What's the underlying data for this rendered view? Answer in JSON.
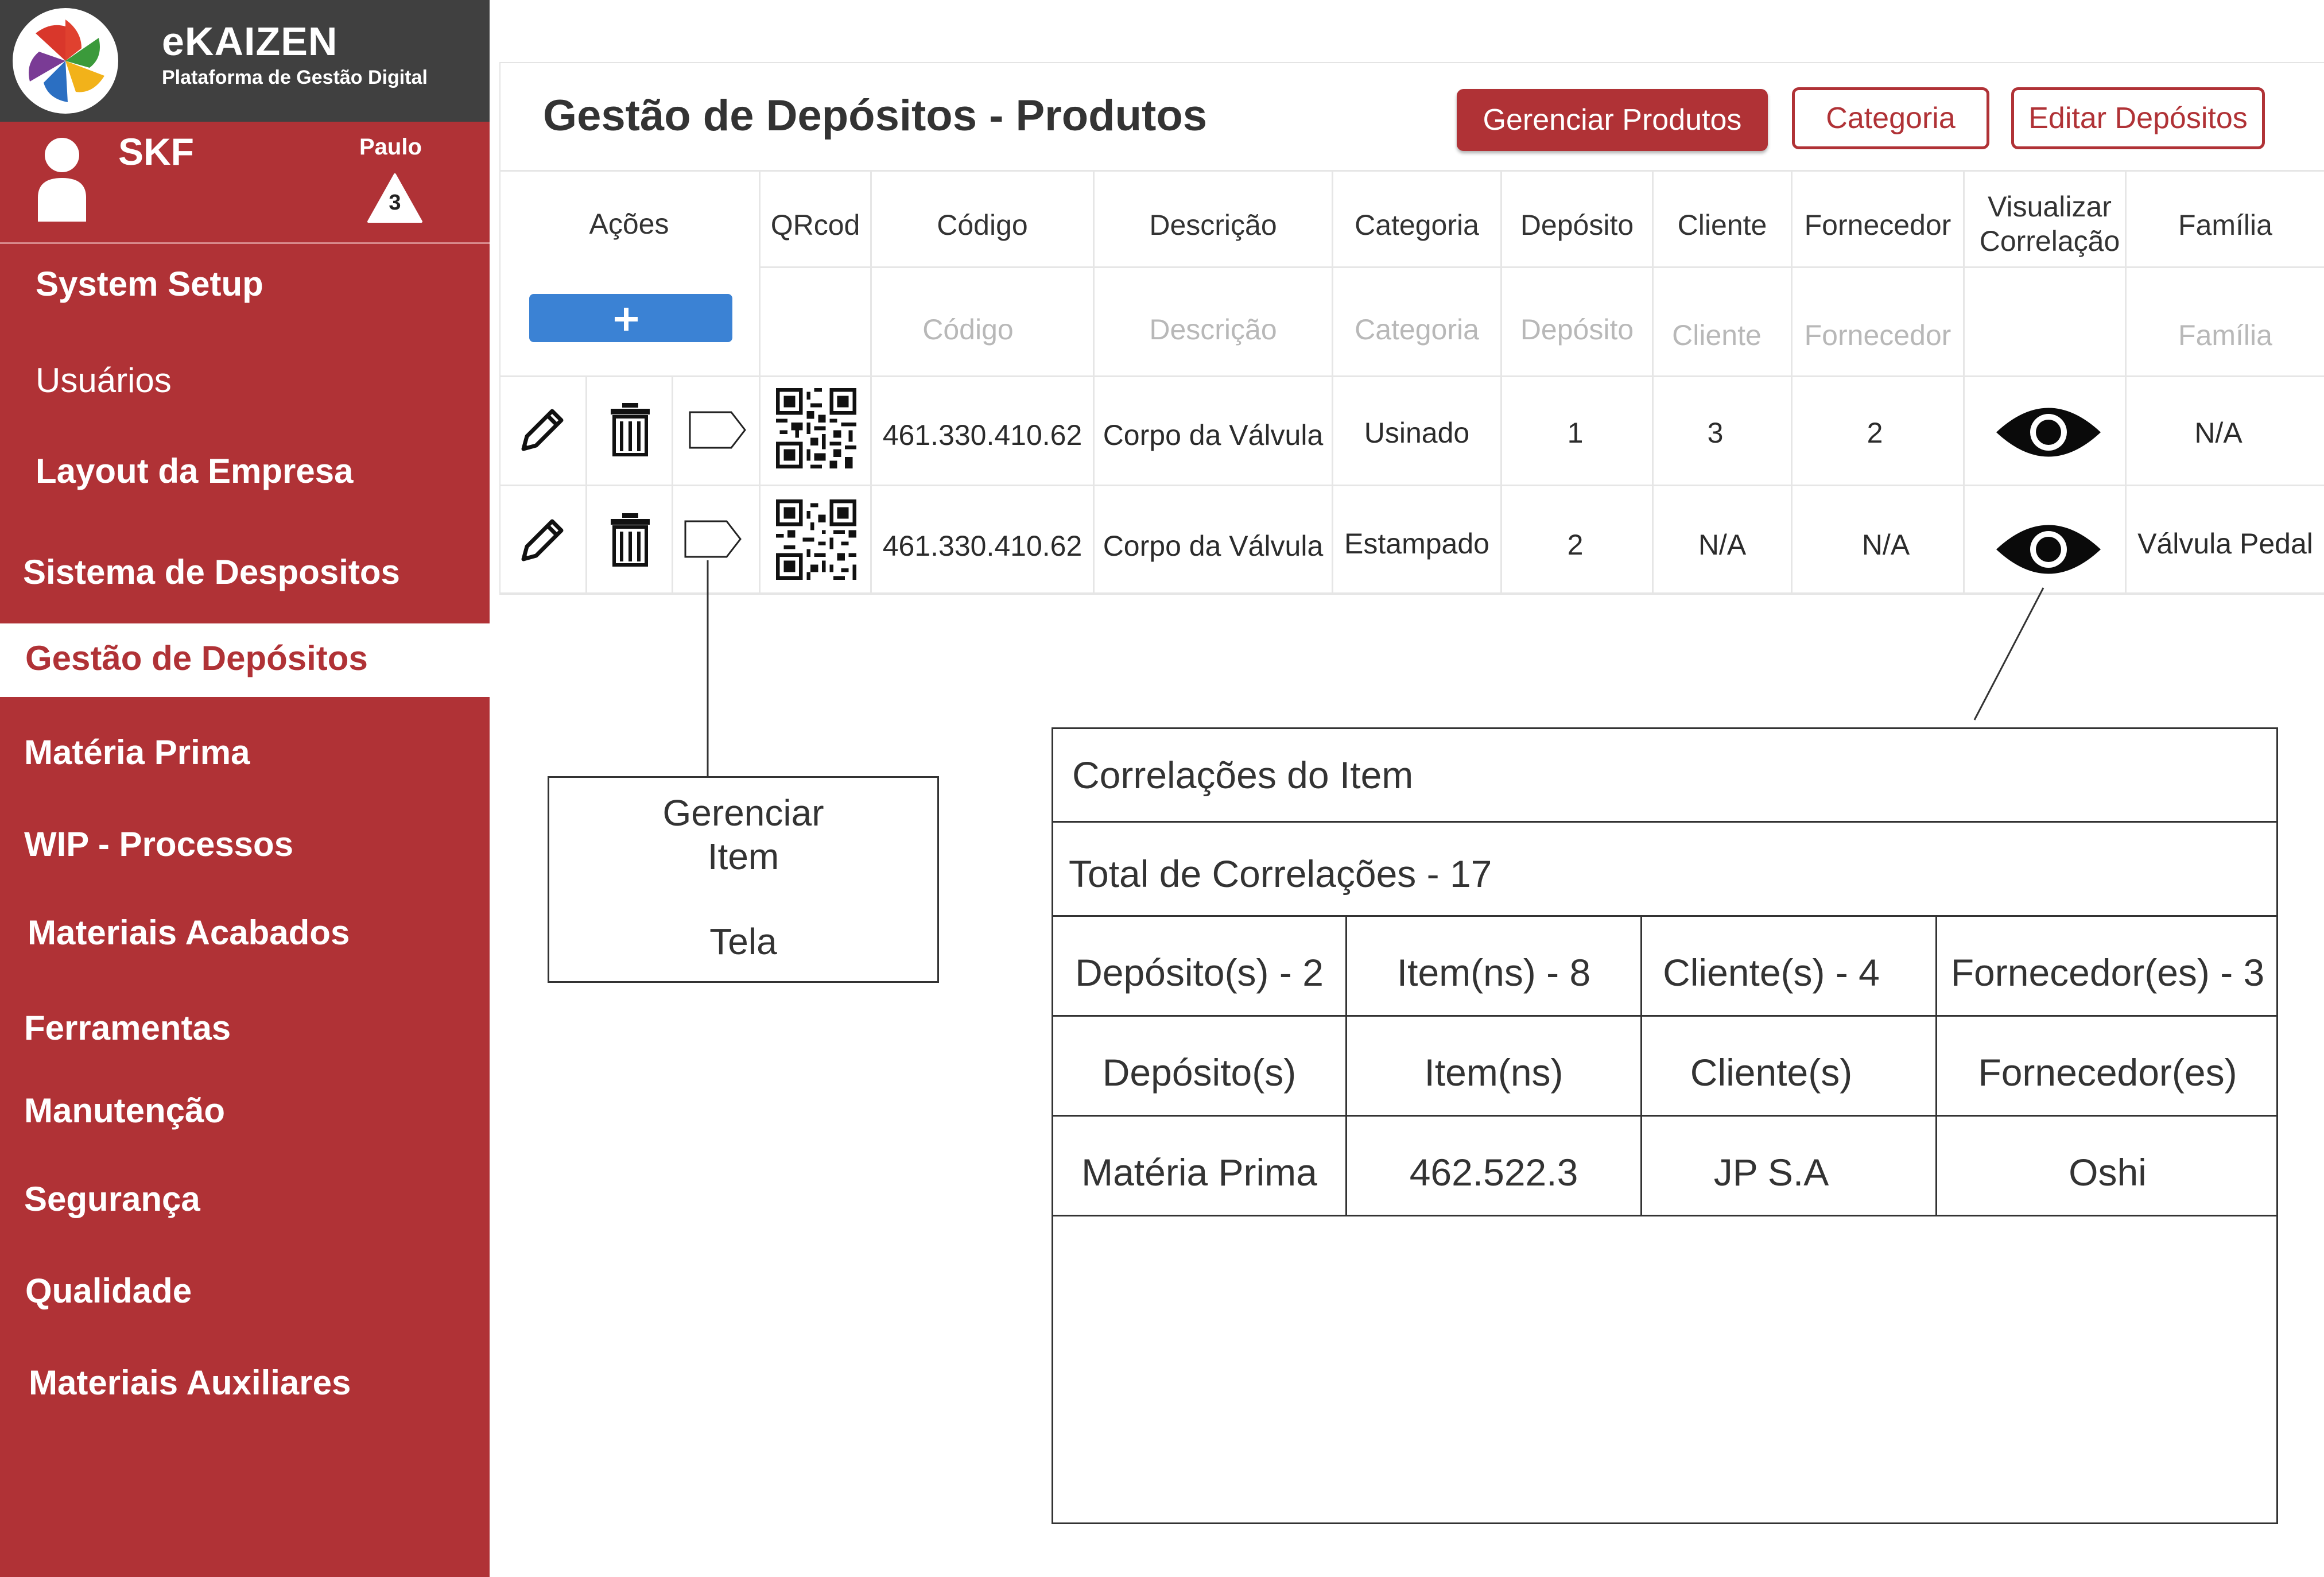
{
  "brand": {
    "name": "eKAIZEN",
    "subtitle": "Plataforma de Gestão Digital"
  },
  "user": {
    "company": "SKF",
    "name": "Paulo",
    "notifications": "3"
  },
  "sidebar": {
    "items": [
      {
        "label": "System Setup"
      },
      {
        "label": "Usuários"
      },
      {
        "label": "Layout da Empresa"
      },
      {
        "label": "Sistema de Despositos"
      },
      {
        "label": "Gestão de Depósitos",
        "active": true
      },
      {
        "label": "Matéria Prima"
      },
      {
        "label": "WIP - Processos"
      },
      {
        "label": "Materiais Acabados"
      },
      {
        "label": "Ferramentas"
      },
      {
        "label": "Manutenção"
      },
      {
        "label": "Segurança"
      },
      {
        "label": "Qualidade"
      },
      {
        "label": "Materiais Auxiliares"
      }
    ]
  },
  "header": {
    "title": "Gestão de Depósitos - Produtos",
    "buttons": {
      "manage": "Gerenciar Produtos",
      "category": "Categoria",
      "edit": "Editar Depósitos"
    }
  },
  "table": {
    "headers": [
      "Ações",
      "QRcod",
      "Código",
      "Descrição",
      "Categoria",
      "Depósito",
      "Cliente",
      "Fornecedor",
      "Visualizar Correlação",
      "Família"
    ],
    "filters": {
      "codigo": "Código",
      "descricao": "Descrição",
      "categoria": "Categoria",
      "deposito": "Depósito",
      "cliente": "Cliente",
      "fornecedor": "Fornecedor",
      "familia": "Família"
    },
    "add_label": "+",
    "rows": [
      {
        "codigo": "461.330.410.62",
        "descricao": "Corpo da Válvula",
        "categoria": "Usinado",
        "deposito": "1",
        "cliente": "3",
        "fornecedor": "2",
        "familia": "N/A"
      },
      {
        "codigo": "461.330.410.62",
        "descricao": "Corpo da Válvula",
        "categoria": "Estampado",
        "deposito": "2",
        "cliente": "N/A",
        "fornecedor": "N/A",
        "familia": "Válvula Pedal"
      }
    ]
  },
  "callout": {
    "line1": "Gerenciar",
    "line2": "Item",
    "line3": "Tela"
  },
  "correlations": {
    "title": "Correlações do Item",
    "total": "Total de Correlações - 17",
    "counts": [
      "Depósito(s) - 2",
      "Item(ns) - 8",
      "Cliente(s) - 4",
      "Fornecedor(es) - 3"
    ],
    "headers": [
      "Depósito(s)",
      "Item(ns)",
      "Cliente(s)",
      "Fornecedor(es)"
    ],
    "values": [
      "Matéria Prima",
      "462.522.3",
      "JP S.A",
      "Oshi"
    ]
  },
  "colors": {
    "sidebar": "#b03236",
    "brand_bar": "#404040",
    "add_button": "#3b82d4"
  }
}
